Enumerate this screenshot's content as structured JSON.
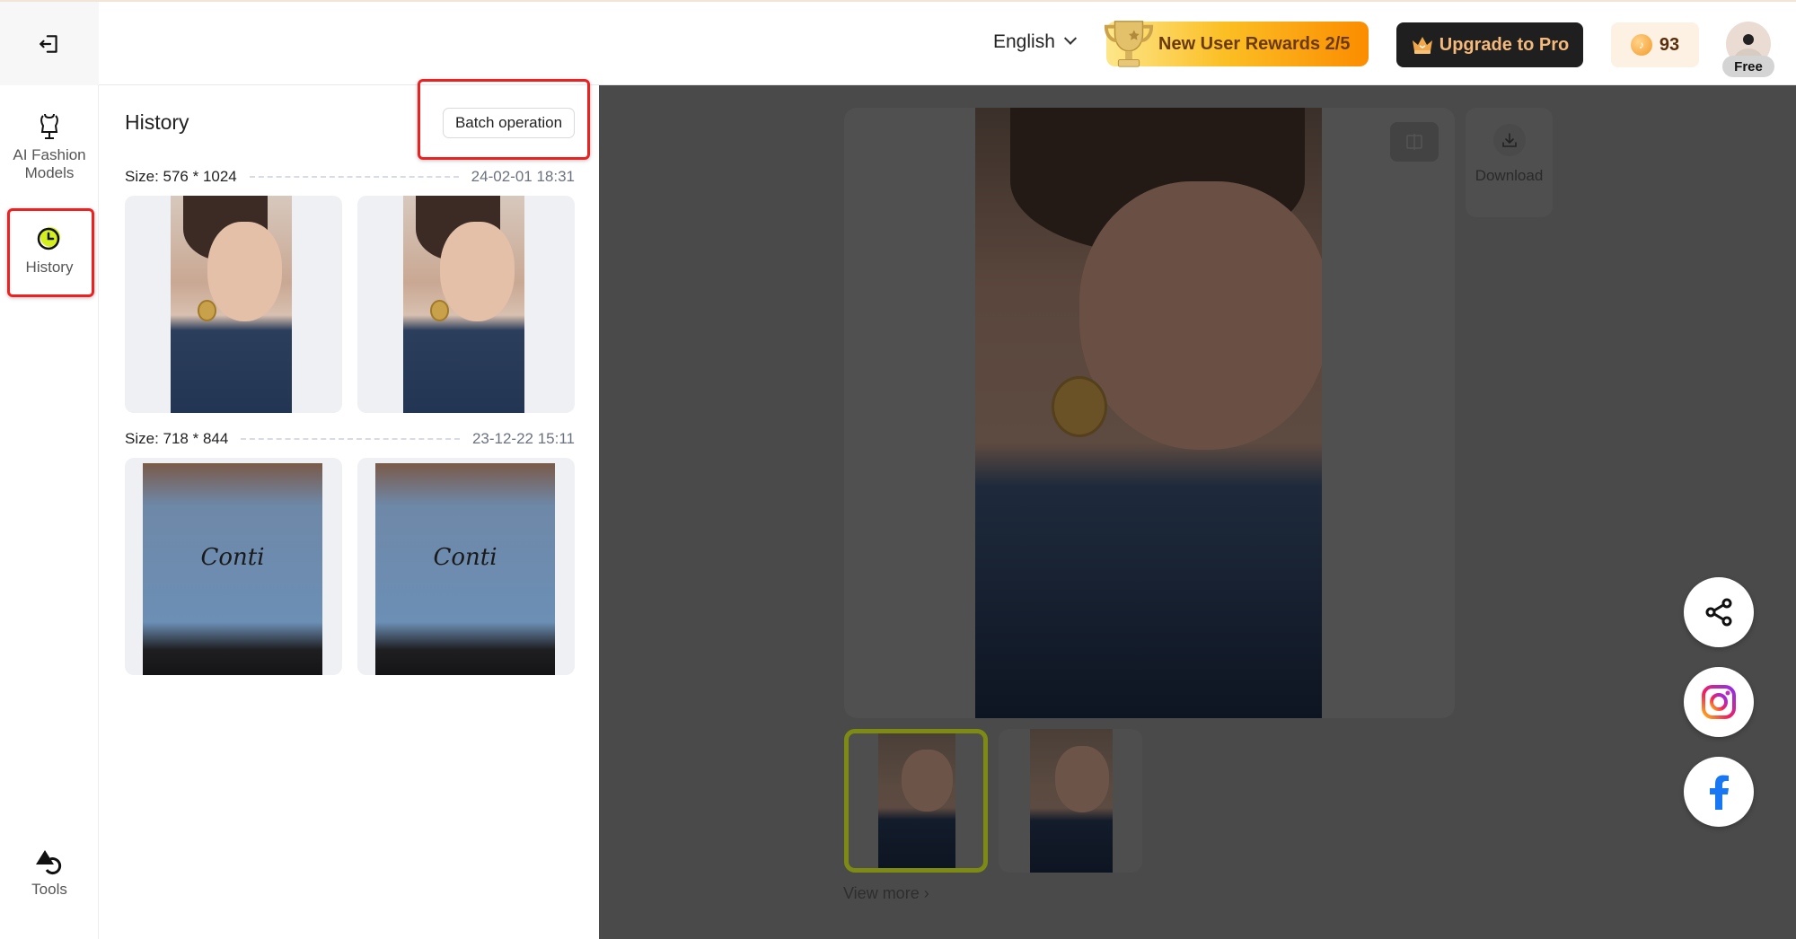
{
  "header": {
    "language": "English",
    "rewards_label": "New User Rewards 2/5",
    "upgrade_label": "Upgrade to Pro",
    "coins": "93",
    "plan_badge": "Free"
  },
  "sidebar": {
    "items": [
      {
        "label": "AI Fashion Models",
        "icon": "dress-form-icon"
      },
      {
        "label": "History",
        "icon": "clock-icon",
        "active": true
      },
      {
        "label": "Tools",
        "icon": "shapes-tools-icon"
      }
    ],
    "accent_color": "#d4f01c"
  },
  "history": {
    "title": "History",
    "batch_label": "Batch operation",
    "groups": [
      {
        "size": "Size: 576 * 1024",
        "time": "24-02-01 18:31",
        "thumbs": 2
      },
      {
        "size": "Size: 718 * 844",
        "time": "23-12-22 15:11",
        "thumbs": 2
      }
    ],
    "hoodie_text": "Conti"
  },
  "preview": {
    "download_label": "Download",
    "view_more_label": "View more ›",
    "selected_border_color": "#7d8b12"
  },
  "social": [
    {
      "name": "share"
    },
    {
      "name": "instagram"
    },
    {
      "name": "facebook"
    }
  ],
  "annotations": {
    "highlight_color": "#ee2020"
  }
}
